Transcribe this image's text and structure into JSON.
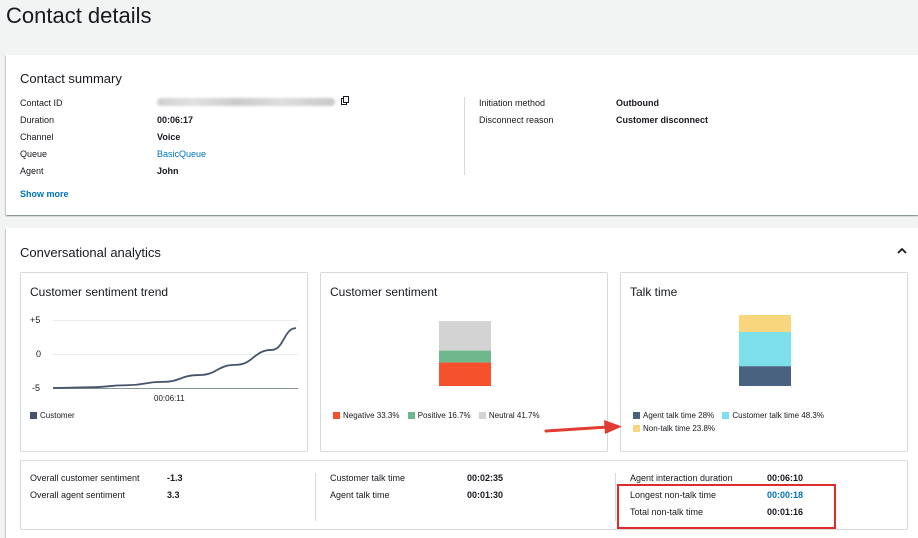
{
  "page": {
    "title": "Contact details"
  },
  "summary": {
    "title": "Contact summary",
    "left_fields": [
      {
        "label": "Contact ID",
        "value": ""
      },
      {
        "label": "Duration",
        "value": "00:06:17"
      },
      {
        "label": "Channel",
        "value": "Voice"
      },
      {
        "label": "Queue",
        "value": "BasicQueue"
      },
      {
        "label": "Agent",
        "value": "John"
      }
    ],
    "right_fields": [
      {
        "label": "Initiation method",
        "value": "Outbound"
      },
      {
        "label": "Disconnect reason",
        "value": "Customer disconnect"
      }
    ],
    "show_more": "Show more"
  },
  "analytics": {
    "title": "Conversational analytics",
    "trend": {
      "title": "Customer sentiment trend",
      "y_ticks": [
        "+5",
        "0",
        "-5"
      ],
      "x_tick": "00:06:11",
      "legend": "Customer"
    },
    "sentiment": {
      "title": "Customer sentiment",
      "legend": [
        "Negative 33.3%",
        "Positive 16.7%",
        "Neutral 41.7%"
      ]
    },
    "talk": {
      "title": "Talk time",
      "legend": [
        "Agent talk time 28%",
        "Customer talk time 48.3%",
        "Non-talk time 23.8%"
      ]
    },
    "stats": {
      "col1": [
        {
          "label": "Overall customer sentiment",
          "value": "-1.3"
        },
        {
          "label": "Overall agent sentiment",
          "value": "3.3"
        }
      ],
      "col2": [
        {
          "label": "Customer talk time",
          "value": "00:02:35"
        },
        {
          "label": "Agent talk time",
          "value": "00:01:30"
        }
      ],
      "col3": [
        {
          "label": "Agent interaction duration",
          "value": "00:06:10"
        },
        {
          "label": "Longest non-talk time",
          "value": "00:00:18"
        },
        {
          "label": "Total non-talk time",
          "value": "00:01:16"
        }
      ]
    }
  },
  "chart_data": [
    {
      "type": "line",
      "title": "Customer sentiment trend",
      "xlabel": "",
      "ylabel": "",
      "ylim": [
        -5,
        5
      ],
      "x_ticks": [
        "00:06:11"
      ],
      "series": [
        {
          "name": "Customer",
          "color": "#44546a",
          "points": [
            [
              0,
              -5
            ],
            [
              0.15,
              -4.9
            ],
            [
              0.3,
              -4.6
            ],
            [
              0.45,
              -4.1
            ],
            [
              0.6,
              -3.1
            ],
            [
              0.75,
              -1.6
            ],
            [
              0.9,
              0.6
            ],
            [
              1.0,
              3.8
            ]
          ]
        }
      ],
      "legend_position": "bottom-left"
    },
    {
      "type": "bar",
      "subtype": "stacked",
      "title": "Customer sentiment",
      "categories": [
        "Customer sentiment"
      ],
      "series": [
        {
          "name": "Negative",
          "values": [
            33.3
          ],
          "color": "#f4512c"
        },
        {
          "name": "Positive",
          "values": [
            16.7
          ],
          "color": "#6fb88d"
        },
        {
          "name": "Neutral",
          "values": [
            41.7
          ],
          "color": "#d3d3d3"
        }
      ],
      "legend_position": "bottom-left"
    },
    {
      "type": "bar",
      "subtype": "stacked",
      "title": "Talk time",
      "categories": [
        "Talk time"
      ],
      "series": [
        {
          "name": "Agent talk time",
          "values": [
            28
          ],
          "color": "#49627f"
        },
        {
          "name": "Customer talk time",
          "values": [
            48.3
          ],
          "color": "#7cdfea"
        },
        {
          "name": "Non-talk time",
          "values": [
            23.8
          ],
          "color": "#f8d67d"
        }
      ],
      "legend_position": "bottom-left"
    }
  ],
  "colors": {
    "link": "#0073bb",
    "highlight": "#e02b2b",
    "arrow": "#e03c31"
  }
}
